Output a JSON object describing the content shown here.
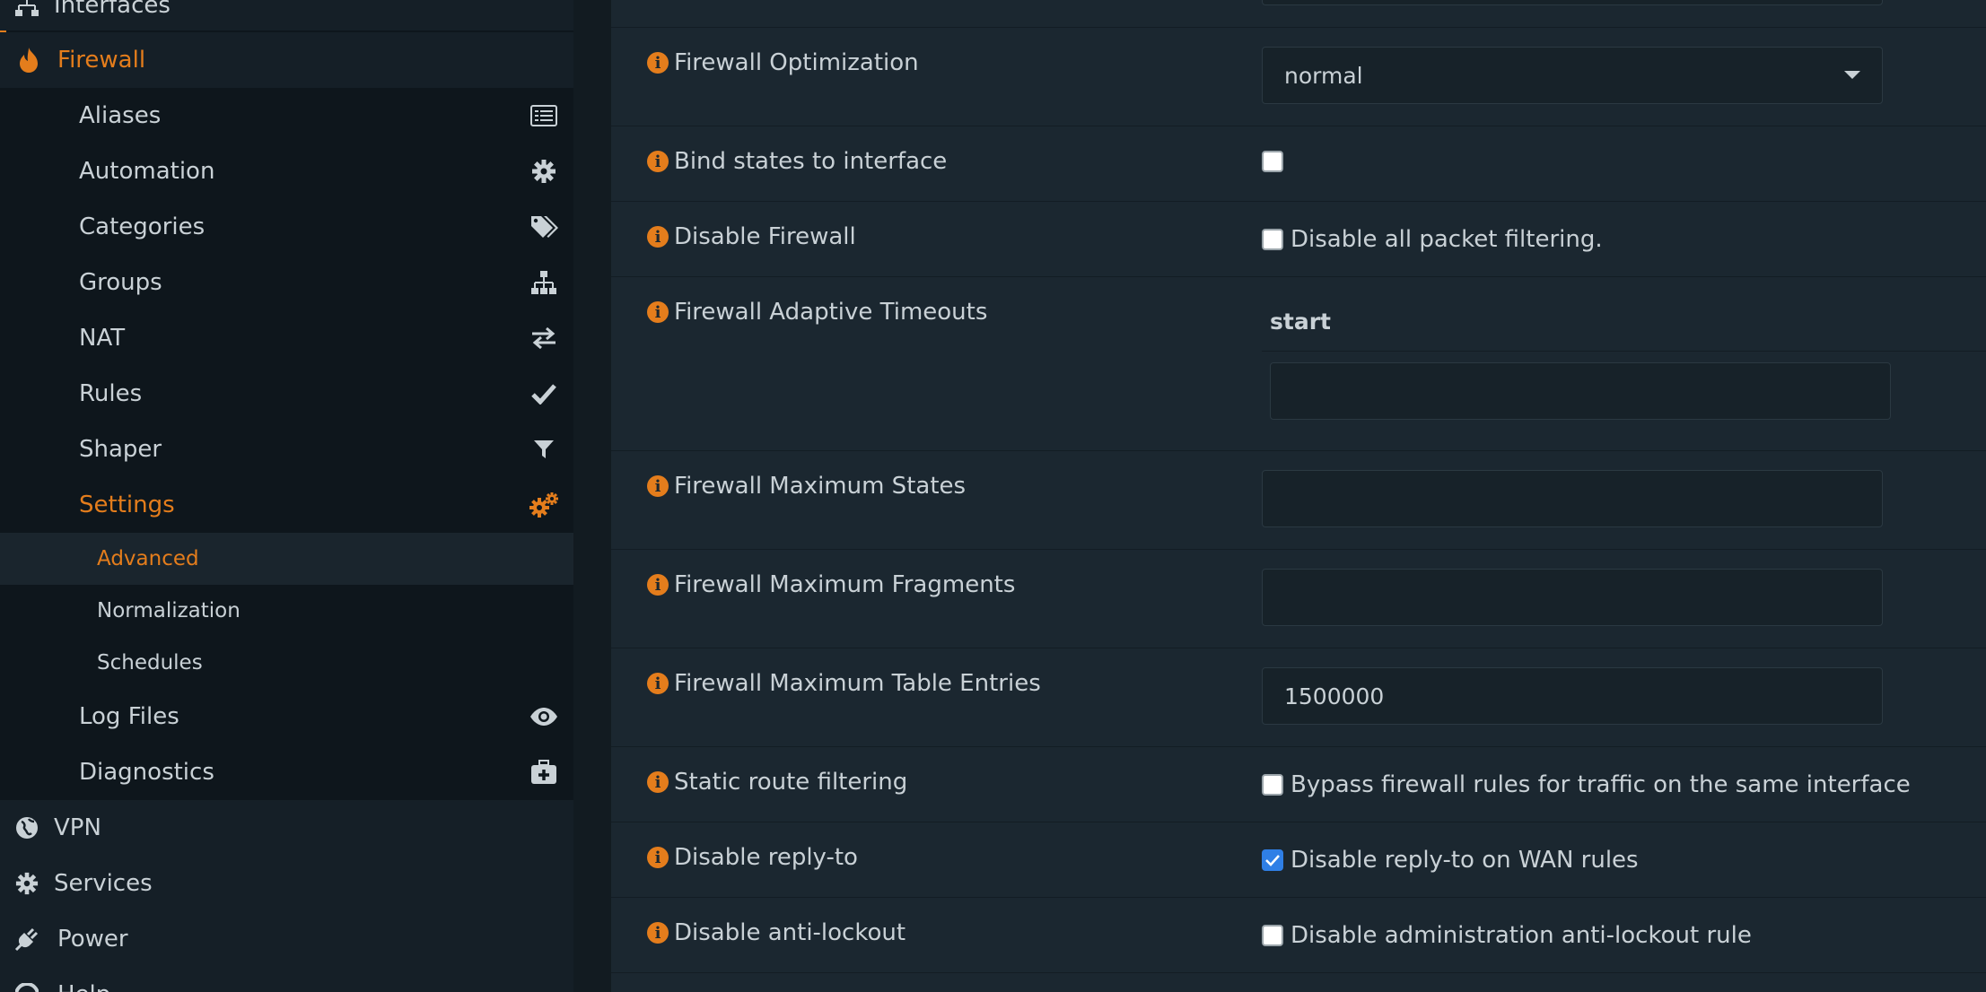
{
  "sidebar": {
    "interfaces_label": "Interfaces",
    "firewall_label": "Firewall",
    "items": [
      {
        "label": "Aliases",
        "icon": "list-icon"
      },
      {
        "label": "Automation",
        "icon": "gear-icon"
      },
      {
        "label": "Categories",
        "icon": "tags-icon"
      },
      {
        "label": "Groups",
        "icon": "sitemap-icon"
      },
      {
        "label": "NAT",
        "icon": "exchange-icon"
      },
      {
        "label": "Rules",
        "icon": "check-icon"
      },
      {
        "label": "Shaper",
        "icon": "filter-icon"
      },
      {
        "label": "Settings",
        "icon": "gears-icon"
      }
    ],
    "settings_sub": [
      "Advanced",
      "Normalization",
      "Schedules"
    ],
    "log_files_label": "Log Files",
    "diagnostics_label": "Diagnostics",
    "vpn_label": "VPN",
    "services_label": "Services",
    "power_label": "Power",
    "help_label": "Help"
  },
  "form": {
    "optimization": {
      "label": "Firewall Optimization",
      "value": "normal"
    },
    "bind_states": {
      "label": "Bind states to interface",
      "checked": false
    },
    "disable_firewall": {
      "label": "Disable Firewall",
      "desc": "Disable all packet filtering.",
      "checked": false
    },
    "adaptive_timeouts": {
      "label": "Firewall Adaptive Timeouts",
      "sub_label": "start",
      "value": ""
    },
    "max_states": {
      "label": "Firewall Maximum States",
      "value": ""
    },
    "max_fragments": {
      "label": "Firewall Maximum Fragments",
      "value": ""
    },
    "max_table_entries": {
      "label": "Firewall Maximum Table Entries",
      "value": "1500000"
    },
    "static_route": {
      "label": "Static route filtering",
      "desc": "Bypass firewall rules for traffic on the same interface",
      "checked": false
    },
    "reply_to": {
      "label": "Disable reply-to",
      "desc": "Disable reply-to on WAN rules",
      "checked": true
    },
    "anti_lockout": {
      "label": "Disable anti-lockout",
      "desc": "Disable administration anti-lockout rule",
      "checked": false
    }
  },
  "colors": {
    "accent": "#e47d1c",
    "checkbox_checked": "#2f7fe6"
  }
}
